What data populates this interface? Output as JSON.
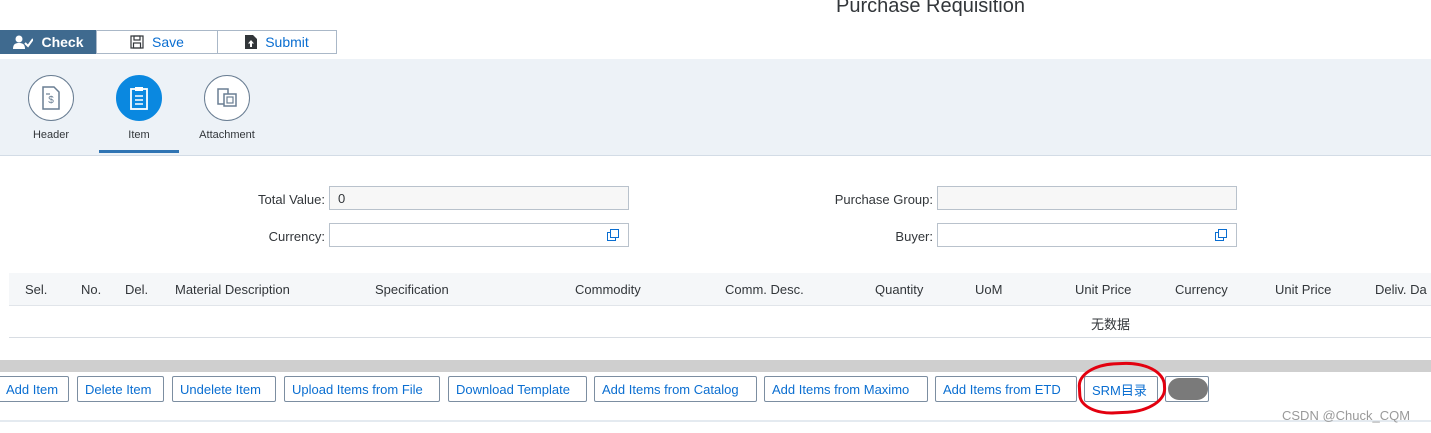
{
  "page_title": "Purchase Requisition",
  "toolbar": {
    "check_label": "Check",
    "save_label": "Save",
    "submit_label": "Submit"
  },
  "tabs": [
    {
      "label": "Header",
      "icon": "document-dollar-icon"
    },
    {
      "label": "Item",
      "icon": "clipboard-icon",
      "active": true
    },
    {
      "label": "Attachment",
      "icon": "attachment-copy-icon"
    }
  ],
  "form": {
    "total_value_label": "Total Value:",
    "total_value": "0",
    "currency_label": "Currency:",
    "currency_value": "",
    "purchase_group_label": "Purchase Group:",
    "purchase_group_value": "",
    "buyer_label": "Buyer:",
    "buyer_value": ""
  },
  "table": {
    "columns": [
      "Sel.",
      "No.",
      "Del.",
      "Material Description",
      "Specification",
      "Commodity",
      "Comm. Desc.",
      "Quantity",
      "UoM",
      "Unit Price",
      "Currency",
      "Unit Price",
      "Deliv. Da"
    ],
    "no_data": "无数据"
  },
  "footer_buttons": [
    "Add Item",
    "Delete Item",
    "Undelete Item",
    "Upload Items from File",
    "Download Template",
    "Add Items from Catalog",
    "Add Items from Maximo",
    "Add Items from ETD",
    "SRM目录"
  ],
  "watermark": "CSDN @Chuck_CQM",
  "colors": {
    "accent": "#0a6ed1",
    "primary_button": "#3f6a8f",
    "active_tab": "#0a88e0",
    "annotation": "#e3000f"
  }
}
